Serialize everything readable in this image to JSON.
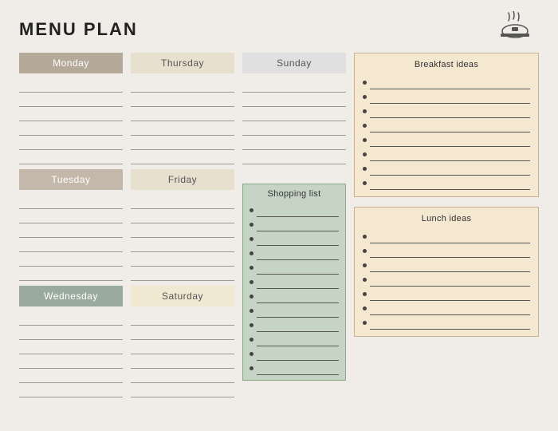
{
  "title": "MENU PLAN",
  "icon": {
    "alt": "food-steam-icon"
  },
  "days": {
    "monday": "Monday",
    "tuesday": "Tuesday",
    "wednesday": "Wednesday",
    "thursday": "Thursday",
    "friday": "Friday",
    "saturday": "Saturday",
    "sunday": "Sunday"
  },
  "shopping": {
    "header": "Shopping list",
    "items": 12
  },
  "breakfast_ideas": {
    "header": "Breakfast ideas",
    "items": 8
  },
  "lunch_ideas": {
    "header": "Lunch ideas",
    "items": 7
  }
}
